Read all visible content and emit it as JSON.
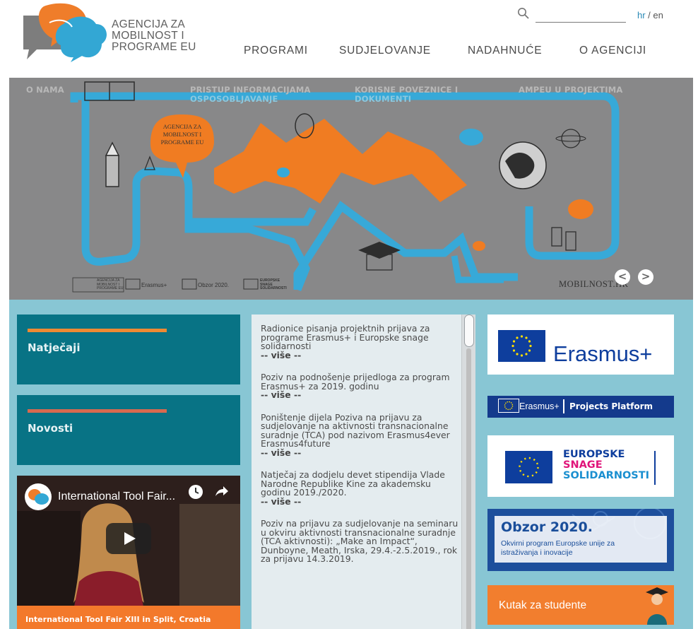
{
  "header": {
    "logo_lines": [
      "AGENCIJA ZA",
      "MOBILNOST I",
      "PROGRAME EU"
    ],
    "search_placeholder": "",
    "lang_hr": "hr",
    "lang_sep": " / ",
    "lang_en": "en",
    "nav": [
      "PROGRAMI",
      "SUDJELOVANJE",
      "NADAHNUĆE",
      "O AGENCIJI"
    ]
  },
  "hero": {
    "subnav": [
      {
        "line1": "O NAMA",
        "line2": ""
      },
      {
        "line1": "PRISTUP INFORMACIJAMA",
        "line2": "OSPOSOBLJAVANJE"
      },
      {
        "line1": "KORISNE POVEZNICE I",
        "line2": "DOKUMENTI"
      },
      {
        "line1": "AMPEU U PROJEKTIMA",
        "line2": ""
      }
    ],
    "bubble_lines": [
      "AGENCIJA ZA",
      "MOBILNOST I",
      "PROGRAME EU"
    ],
    "site": "MOBILNOST.HR",
    "prev": "<",
    "next": ">",
    "foot_logos": {
      "agency_lines": [
        "AGENCIJA ZA",
        "MOBILNOST I",
        "PROGRAME EU"
      ],
      "erasmus": "Erasmus+",
      "obzor": "Obzor 2020.",
      "esc_lines": [
        "EUROPSKE",
        "SNAGE",
        "SOLIDARNOSTI"
      ]
    }
  },
  "left": {
    "natjecaji": "Natječaji",
    "novosti": "Novosti",
    "video_title": "International Tool Fair...",
    "video_caption": "International Tool Fair XIII in Split, Croatia"
  },
  "news": [
    {
      "text": "Radionice pisanja projektnih prijava za programe Erasmus+ i Europske snage solidarnosti",
      "more": "-- više --"
    },
    {
      "text": "Poziv na podnošenje prijedloga za program Erasmus+ za 2019. godinu",
      "more": "-- više --"
    },
    {
      "text": "Poništenje dijela Poziva na prijavu za sudjelovanje na aktivnosti transnacionalne suradnje (TCA) pod nazivom Erasmus4ever Erasmus4future",
      "more": "-- više --"
    },
    {
      "text": "Natječaj za dodjelu devet stipendija Vlade Narodne Republike Kine za akademsku godinu 2019./2020.",
      "more": "-- više --"
    },
    {
      "text": "Poziv na prijavu za sudjelovanje na seminaru u okviru aktivnosti transnacionalne suradnje (TCA aktivnosti): „Make an Impact“, Dunboyne, Meath, Irska, 29.4.-2.5.2019., rok za prijavu 14.3.2019.",
      "more": ""
    }
  ],
  "right": {
    "erasmus_big": "Erasmus+",
    "erasmus_bar_left": "Erasmus+",
    "erasmus_bar_right": "Projects Platform",
    "esc_lines": [
      "EUROPSKE",
      "SNAGE",
      "SOLIDARNOSTI"
    ],
    "obzor_title": "Obzor 2020.",
    "obzor_sub_lines": [
      "Okvirni program Europske unije za",
      "istraživanja i inovacije"
    ],
    "kutak": "Kutak za studente"
  },
  "colors": {
    "teal": "#087385",
    "orange": "#f27e2e",
    "hero_gray": "#888889",
    "light_blue_bg": "#88c6d4",
    "eu_blue": "#0e3e9d"
  }
}
